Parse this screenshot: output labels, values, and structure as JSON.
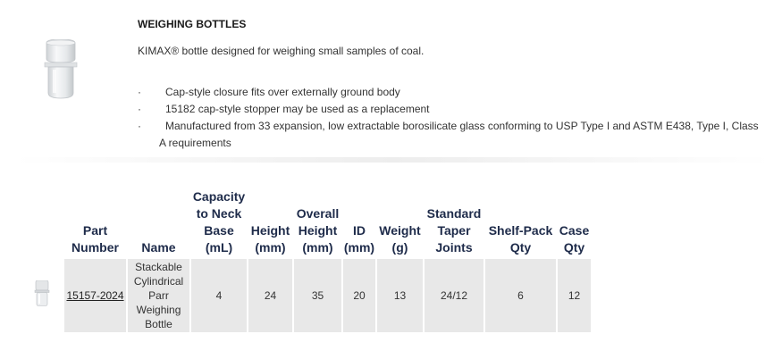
{
  "product": {
    "title": "WEIGHING BOTTLES",
    "description": "KIMAX® bottle designed for weighing small samples of coal.",
    "bullet_marker": "·",
    "bullets": [
      "Cap-style closure fits over externally ground body",
      "15182 cap-style stopper may be used as a replacement",
      "Manufactured from 33 expansion, low extractable borosilicate glass conforming to USP Type I and ASTM E438, Type I, Class A requirements"
    ],
    "bullet_3_line1": "Manufactured from 33 expansion, low extractable borosilicate glass conforming to USP Type I and ASTM E438, Type I, Class",
    "bullet_3_line2": "A requirements"
  },
  "table": {
    "headers": {
      "part_number": "Part Number",
      "name": "Name",
      "capacity": "Capacity to Neck Base (mL)",
      "height": "Height (mm)",
      "overall_height": "Overall Height (mm)",
      "id": "ID (mm)",
      "weight": "Weight (g)",
      "taper": "Standard Taper Joints",
      "shelf_pack": "Shelf-Pack Qty",
      "case_qty": "Case Qty"
    },
    "rows": [
      {
        "part_number": "15157-2024",
        "name": "Stackable Cylindrical Parr Weighing Bottle",
        "capacity": "4",
        "height": "24",
        "overall_height": "35",
        "id": "20",
        "weight": "13",
        "taper": "24/12",
        "shelf_pack": "6",
        "case_qty": "12"
      }
    ]
  }
}
